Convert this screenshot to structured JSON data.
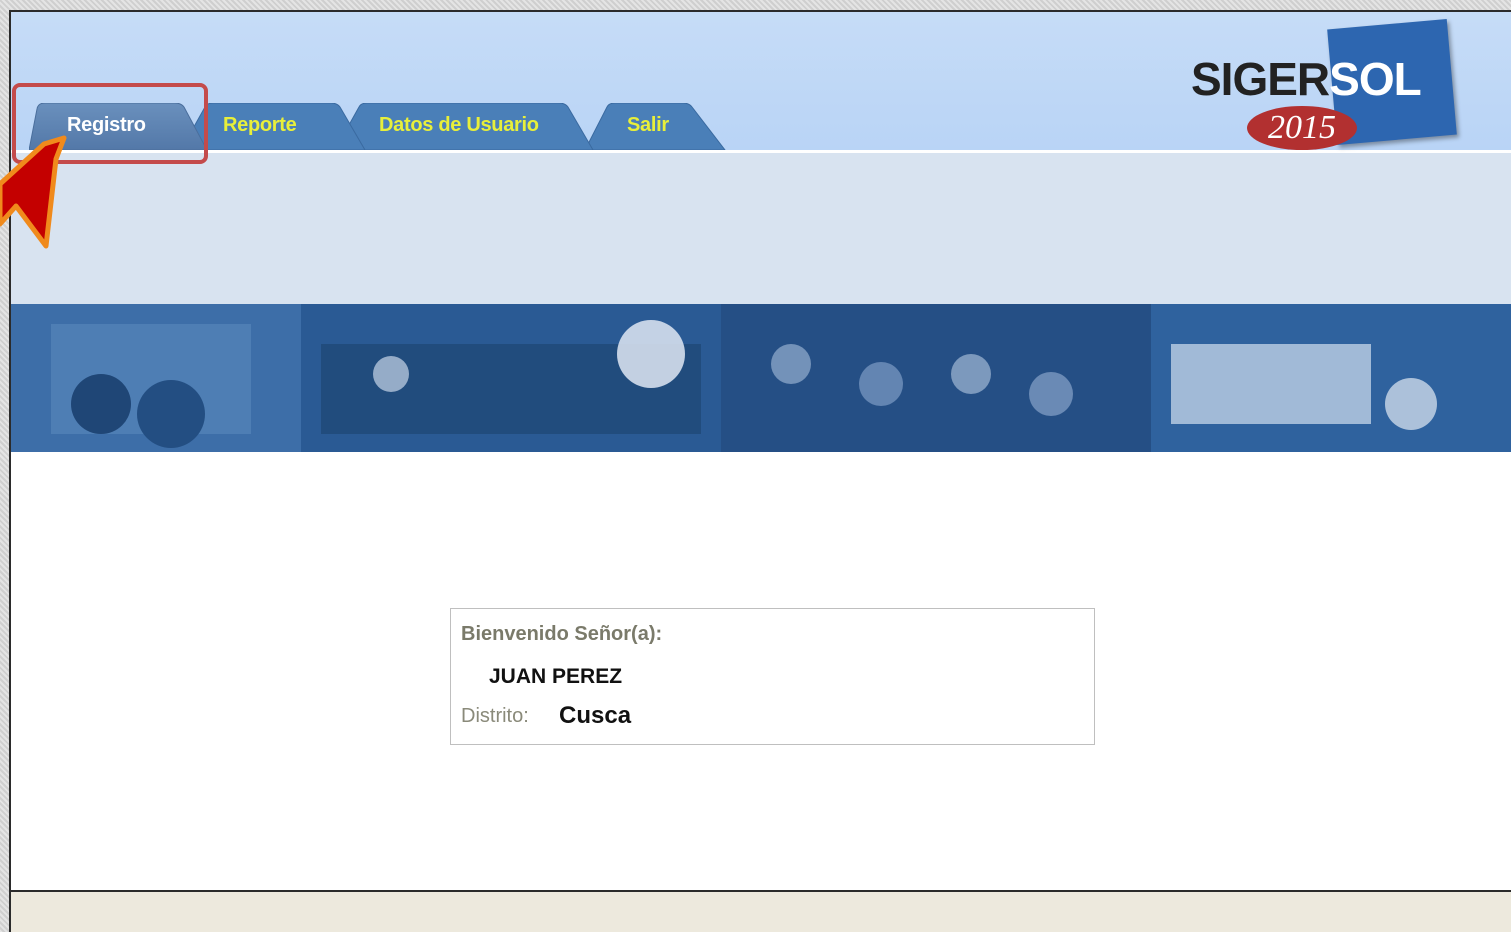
{
  "nav": {
    "tabs": [
      {
        "label": "Registro",
        "active": true
      },
      {
        "label": "Reporte",
        "active": false
      },
      {
        "label": "Datos de Usuario",
        "active": false
      },
      {
        "label": "Salir",
        "active": false
      }
    ]
  },
  "logo": {
    "part1": "SIGER",
    "part2": "SOL",
    "year": "2015"
  },
  "welcome": {
    "greeting": "Bienvenido Señor(a):",
    "user_name": "JUAN PEREZ",
    "district_label": "Distrito:",
    "district_value": "Cusca"
  },
  "colors": {
    "header_bg": "#c6dcf7",
    "tab_active": "#5b83b3",
    "tab_inactive": "#4a7fb8",
    "tab_inactive_text": "#e8ef3a",
    "banner": "#2a5f9b",
    "highlight": "#c44b4b",
    "arrow": "#c40000",
    "arrow_outline": "#f08a1c"
  }
}
